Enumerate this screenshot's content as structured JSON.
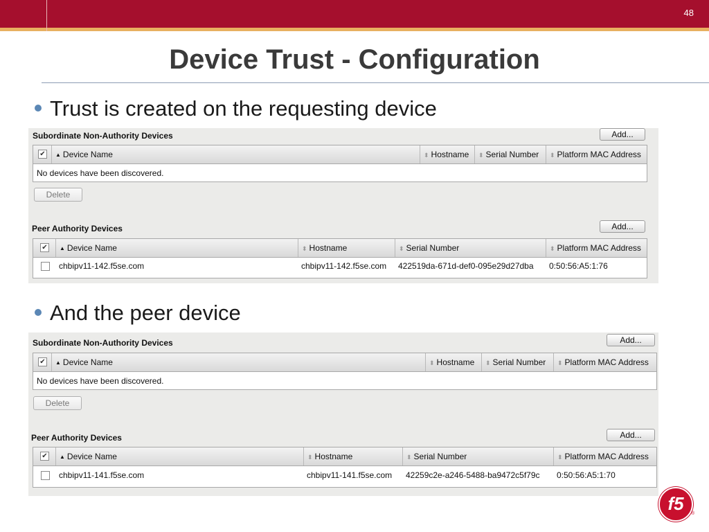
{
  "slide": {
    "number": "48",
    "title": "Device Trust - Configuration",
    "bullets": [
      "Trust is created on the  requesting device",
      "And the peer device"
    ]
  },
  "panels": [
    {
      "subordinate": {
        "title": "Subordinate Non-Authority Devices",
        "add_label": "Add...",
        "columns": [
          "Device Name",
          "Hostname",
          "Serial Number",
          "Platform MAC Address"
        ],
        "empty_message": "No devices have been discovered.",
        "delete_label": "Delete"
      },
      "peer": {
        "title": "Peer Authority Devices",
        "add_label": "Add...",
        "columns": [
          "Device Name",
          "Hostname",
          "Serial Number",
          "Platform MAC Address"
        ],
        "row": {
          "device_name": "chbipv11-142.f5se.com",
          "hostname": "chbipv11-142.f5se.com",
          "serial": "422519da-671d-def0-095e29d27dba",
          "mac": "0:50:56:A5:1:76"
        }
      }
    },
    {
      "subordinate": {
        "title": "Subordinate Non-Authority Devices",
        "add_label": "Add...",
        "columns": [
          "Device Name",
          "Hostname",
          "Serial Number",
          "Platform MAC Address"
        ],
        "empty_message": "No devices have been discovered.",
        "delete_label": "Delete"
      },
      "peer": {
        "title": "Peer Authority Devices",
        "add_label": "Add...",
        "columns": [
          "Device Name",
          "Hostname",
          "Serial Number",
          "Platform MAC Address"
        ],
        "row": {
          "device_name": "chbipv11-141.f5se.com",
          "hostname": "chbipv11-141.f5se.com",
          "serial": "42259c2e-a246-5488-ba9472c5f79c",
          "mac": "0:50:56:A5:1:70"
        }
      }
    }
  ],
  "logo": {
    "text": "f5",
    "color": "#c8102e"
  },
  "colors": {
    "header_bar": "#a50f2d",
    "header_stripe": "#e8b060",
    "bullet_dot": "#5b87b5"
  }
}
